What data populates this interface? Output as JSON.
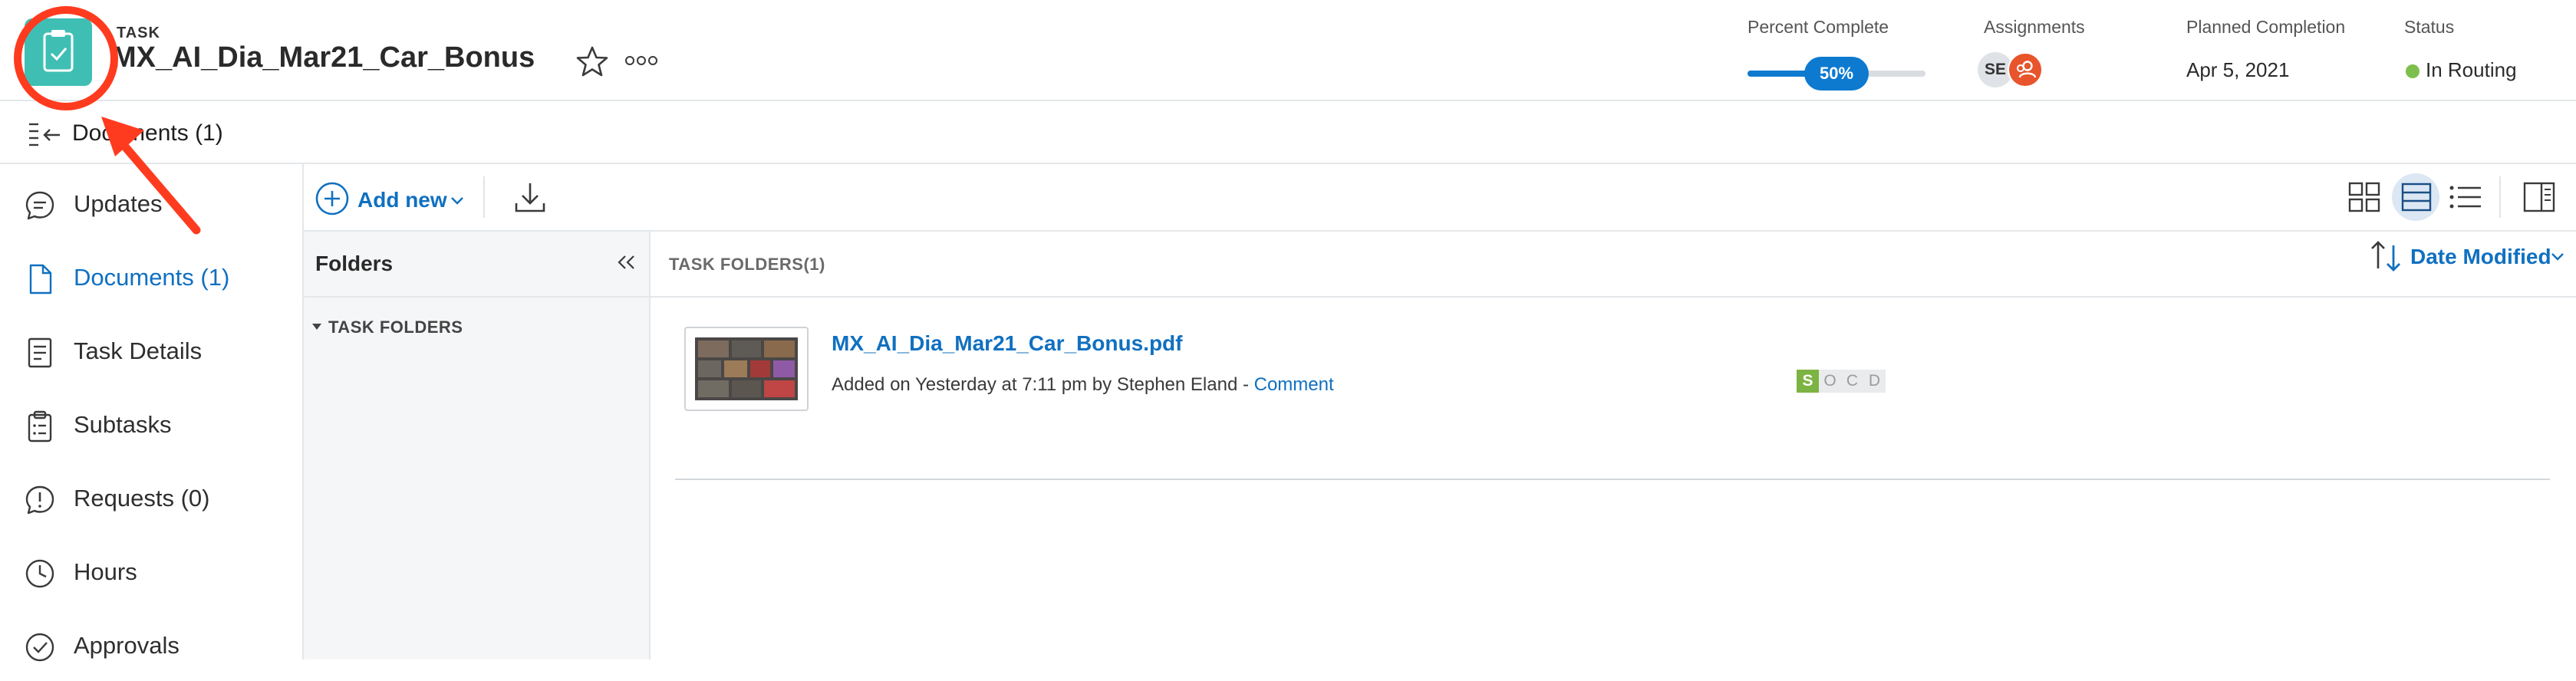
{
  "header": {
    "type_label": "TASK",
    "title": "MX_AI_Dia_Mar21_Car_Bonus",
    "percent_complete": {
      "label": "Percent Complete",
      "value_text": "50%",
      "value": 50
    },
    "assignments": {
      "label": "Assignments",
      "avatar_initials": "SE"
    },
    "planned_completion": {
      "label": "Planned Completion",
      "value": "Apr 5, 2021"
    },
    "status": {
      "label": "Status",
      "value": "In Routing",
      "color": "#7cc04b"
    }
  },
  "subheader": {
    "title": "Documents (1)"
  },
  "nav": {
    "items": [
      {
        "label": "Updates",
        "icon": "comment-icon"
      },
      {
        "label": "Documents (1)",
        "icon": "document-icon",
        "active": true
      },
      {
        "label": "Task Details",
        "icon": "details-icon"
      },
      {
        "label": "Subtasks",
        "icon": "clipboard-icon"
      },
      {
        "label": "Requests (0)",
        "icon": "request-icon"
      },
      {
        "label": "Hours",
        "icon": "clock-icon"
      },
      {
        "label": "Approvals",
        "icon": "check-circle-icon"
      }
    ]
  },
  "toolbar": {
    "add_new_label": "Add new",
    "download_icon": "download-icon",
    "view_icons": [
      "grid-view-icon",
      "card-view-icon",
      "list-view-icon",
      "panel-toggle-icon"
    ]
  },
  "folders": {
    "title": "Folders",
    "task_folders_label": "TASK FOLDERS"
  },
  "list": {
    "heading": "TASK FOLDERS(1)",
    "sort_label": "Date Modified",
    "documents": [
      {
        "name": "MX_AI_Dia_Mar21_Car_Bonus.pdf",
        "meta": "Added on Yesterday at 7:11 pm by Stephen Eland - ",
        "comment_label": "Comment",
        "approval_letters": [
          "S",
          "O",
          "C",
          "D"
        ]
      }
    ]
  },
  "colors": {
    "accent": "#1070c0",
    "task_icon": "#3fbfb4",
    "progress": "#0d7ad0",
    "annotation": "#ff3b1f"
  }
}
